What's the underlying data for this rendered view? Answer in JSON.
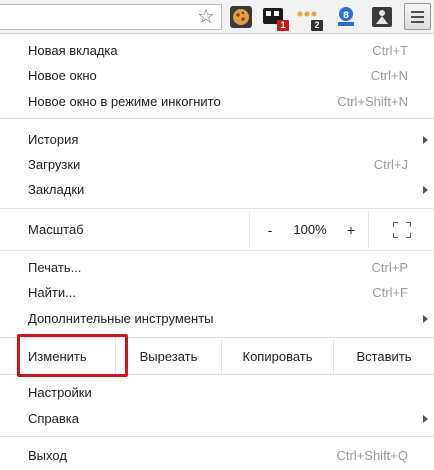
{
  "colors": {
    "highlight": "#d0141b",
    "shortcut_text": "#9b9b9b",
    "text": "#222222"
  },
  "toolbar": {
    "star_icon": "star-icon",
    "extensions": [
      {
        "icon": "cookie-extension-icon",
        "badge": ""
      },
      {
        "icon": "dark-extension-icon",
        "badge": "1"
      },
      {
        "icon": "dots-extension-icon",
        "badge": "2"
      },
      {
        "icon": "blue-badge-extension-icon",
        "badge": ""
      },
      {
        "icon": "dark-tool-extension-icon",
        "badge": ""
      }
    ],
    "menu_icon": "hamburger-menu-icon"
  },
  "menu": {
    "new_tab": {
      "label": "Новая вкладка",
      "shortcut": "Ctrl+T"
    },
    "new_window": {
      "label": "Новое окно",
      "shortcut": "Ctrl+N"
    },
    "new_incognito": {
      "label": "Новое окно в режиме инкогнито",
      "shortcut": "Ctrl+Shift+N"
    },
    "history": {
      "label": "История"
    },
    "downloads": {
      "label": "Загрузки",
      "shortcut": "Ctrl+J"
    },
    "bookmarks": {
      "label": "Закладки"
    },
    "zoom": {
      "label": "Масштаб",
      "minus": "-",
      "value": "100%",
      "plus": "+"
    },
    "print": {
      "label": "Печать...",
      "shortcut": "Ctrl+P"
    },
    "find": {
      "label": "Найти...",
      "shortcut": "Ctrl+F"
    },
    "more_tools": {
      "label": "Дополнительные инструменты"
    },
    "edit": {
      "label": "Изменить",
      "cut": "Вырезать",
      "copy": "Копировать",
      "paste": "Вставить"
    },
    "settings": {
      "label": "Настройки"
    },
    "help": {
      "label": "Справка"
    },
    "exit": {
      "label": "Выход",
      "shortcut": "Ctrl+Shift+Q"
    }
  }
}
